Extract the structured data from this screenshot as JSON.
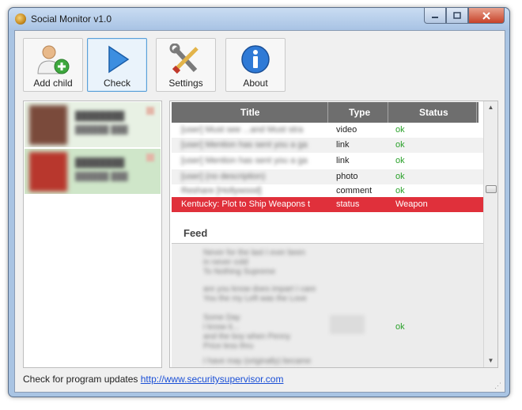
{
  "window": {
    "title": "Social Monitor v1.0"
  },
  "toolbar": {
    "add_child": "Add child",
    "check": "Check",
    "settings": "Settings",
    "about": "About"
  },
  "children": [
    {
      "name": "████████",
      "sub": "██████ ███"
    },
    {
      "name": "████████",
      "sub": "██████ ███"
    }
  ],
  "grid": {
    "columns": [
      "Title",
      "Type",
      "Status"
    ],
    "rows": [
      {
        "title": "[user] Must see ...and Must stra",
        "type": "video",
        "status": "ok"
      },
      {
        "title": "[user] Mention has sent you a ga",
        "type": "link",
        "status": "ok"
      },
      {
        "title": "[user] Mention has sent you a ga",
        "type": "link",
        "status": "ok"
      },
      {
        "title": "[user] (no description)",
        "type": "photo",
        "status": "ok"
      },
      {
        "title": "Reshare [Hollywood]",
        "type": "comment",
        "status": "ok"
      },
      {
        "title": "Kentucky: Plot to Ship Weapons t",
        "type": "status",
        "status": "Weapon"
      }
    ]
  },
  "feed": {
    "title": "Feed",
    "blurred_lines": [
      "Never for the last I ever been",
      "in never cold",
      "To Nothing Supreme",
      "are you know does impart I care",
      "You the my Left was the Love",
      "Some Day",
      "I know it...",
      "and the boy when Penny",
      "Price less thru",
      "I have may (originally) became"
    ],
    "status": "ok"
  },
  "statusbar": {
    "text": "Check for program updates ",
    "link": "http://www.securitysupervisor.com"
  },
  "colors": {
    "alert_row": "#e0303b",
    "ok_text": "#2aa12a",
    "header_bg": "#6e6e6e",
    "link": "#1a4fd6"
  }
}
